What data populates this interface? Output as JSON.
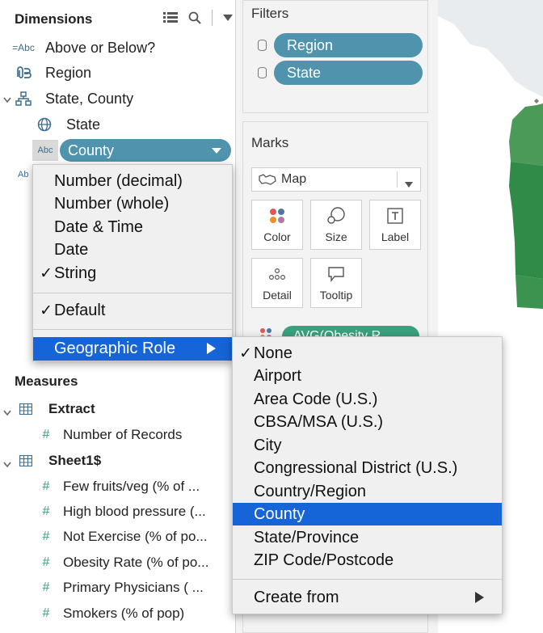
{
  "data_pane": {
    "dimensions_title": "Dimensions",
    "dimensions": [
      {
        "icon": "=Abc",
        "label": "Above or Below?"
      },
      {
        "icon": "paperclip",
        "label": "Region"
      },
      {
        "icon": "hierarchy",
        "label": "State, County"
      },
      {
        "icon": "globe",
        "label": "State"
      },
      {
        "icon": "Abc",
        "label": "County"
      }
    ],
    "partial_icon": "Ab",
    "measures_title": "Measures",
    "measure_groups": [
      {
        "label": "Extract",
        "items": [
          "Number of Records"
        ]
      },
      {
        "label": "Sheet1$",
        "items": [
          "Few fruits/veg (% of ...",
          "High blood pressure (...",
          "Not Exercise (% of po...",
          "Obesity Rate (% of po...",
          "Primary Physicians ( ...",
          "Smokers (% of pop)"
        ]
      }
    ]
  },
  "filters": {
    "title": "Filters",
    "pills": [
      "Region",
      "State"
    ]
  },
  "marks": {
    "title": "Marks",
    "mark_type": "Map",
    "buttons": [
      "Color",
      "Size",
      "Label",
      "Detail",
      "Tooltip"
    ],
    "partial_pill": "AVG(Obesity R..."
  },
  "data_type_menu": {
    "items": [
      {
        "label": "Number (decimal)",
        "checked": false
      },
      {
        "label": "Number (whole)",
        "checked": false
      },
      {
        "label": "Date & Time",
        "checked": false
      },
      {
        "label": "Date",
        "checked": false
      },
      {
        "label": "String",
        "checked": true
      }
    ],
    "default_label": "Default",
    "geo_role_label": "Geographic Role"
  },
  "geo_submenu": {
    "items": [
      {
        "label": "None",
        "checked": true,
        "selected": false
      },
      {
        "label": "Airport",
        "checked": false,
        "selected": false
      },
      {
        "label": "Area Code (U.S.)",
        "checked": false,
        "selected": false
      },
      {
        "label": "CBSA/MSA (U.S.)",
        "checked": false,
        "selected": false
      },
      {
        "label": "City",
        "checked": false,
        "selected": false
      },
      {
        "label": "Congressional District (U.S.)",
        "checked": false,
        "selected": false
      },
      {
        "label": "Country/Region",
        "checked": false,
        "selected": false
      },
      {
        "label": "County",
        "checked": false,
        "selected": true
      },
      {
        "label": "State/Province",
        "checked": false,
        "selected": false
      },
      {
        "label": "ZIP Code/Postcode",
        "checked": false,
        "selected": false
      }
    ],
    "create_from_label": "Create from",
    "check_glyph": "✓"
  },
  "colors": {
    "pill_blue": "#4f93ad",
    "menu_highlight": "#1565d8",
    "measure_green": "#3aa17e",
    "map_green_light": "#7fbf7b",
    "map_green_dark": "#2e8b4a"
  }
}
